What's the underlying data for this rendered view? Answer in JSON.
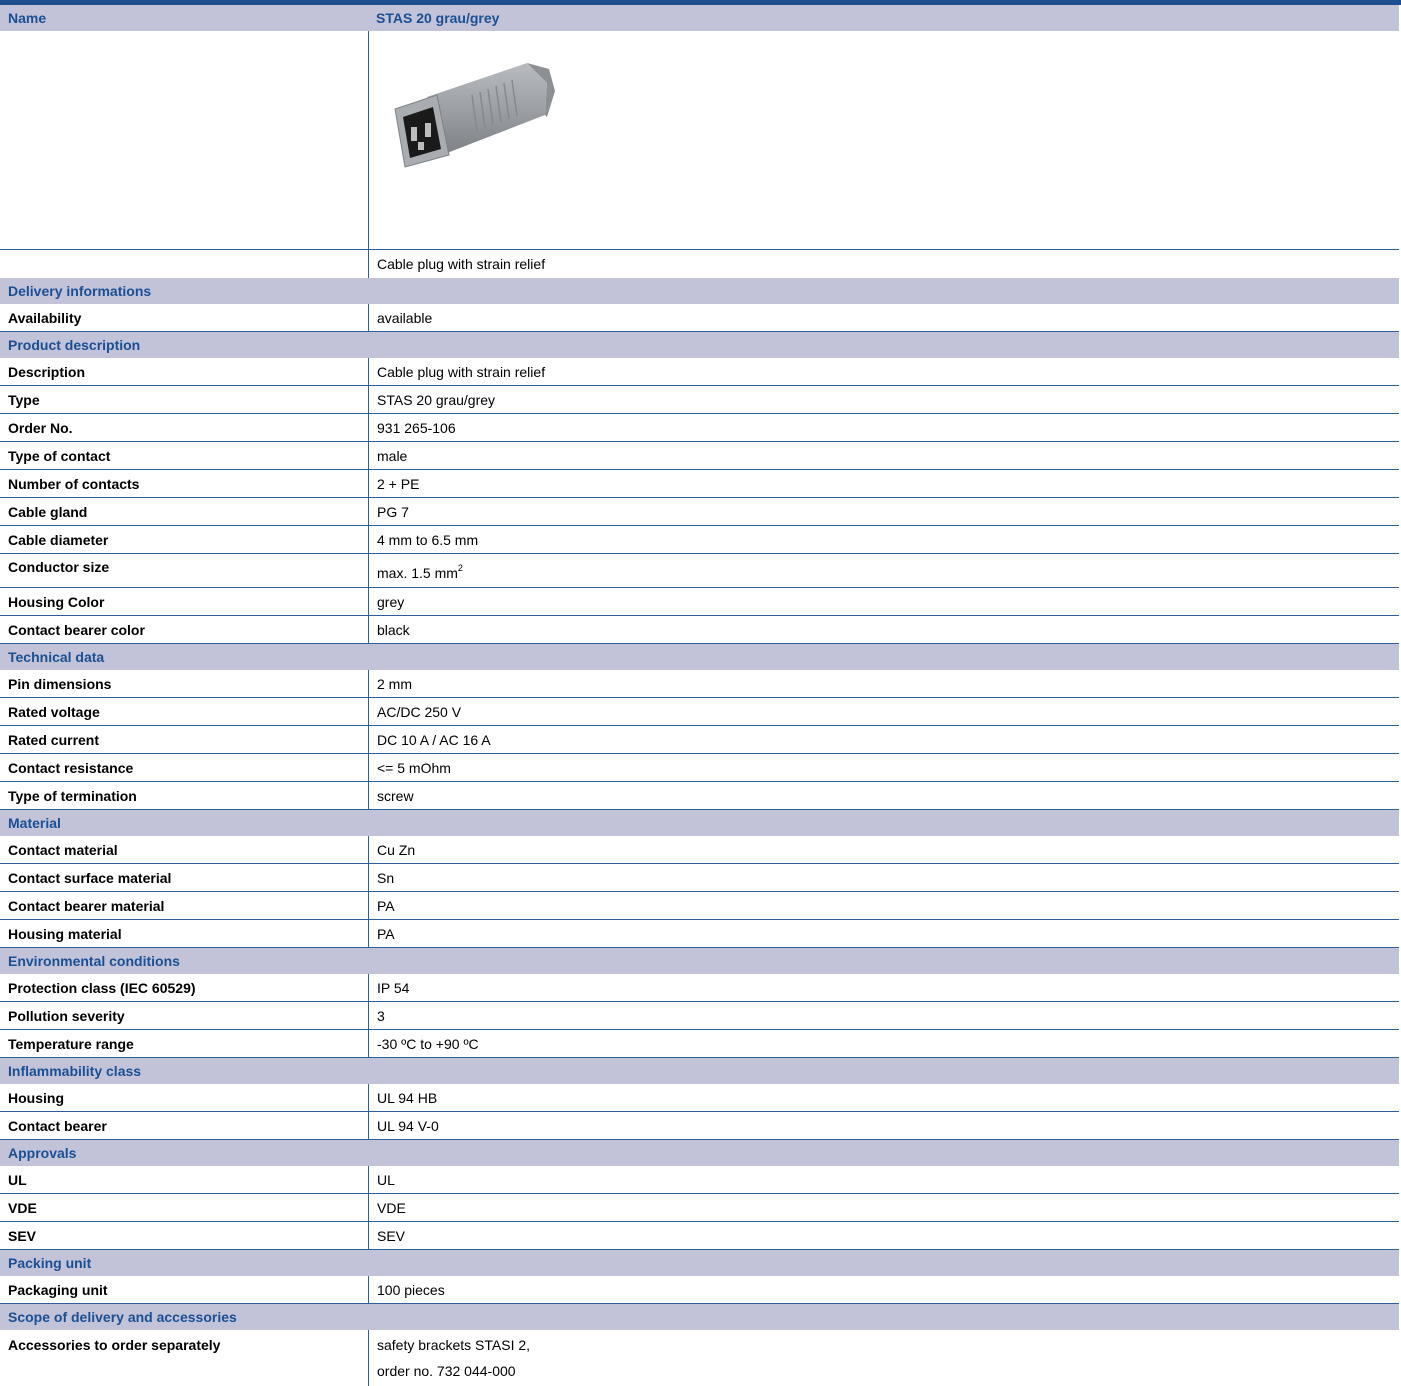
{
  "header": {
    "name_label": "Name",
    "product_name": "STAS 20 grau/grey"
  },
  "image": {
    "caption": "Cable plug with strain relief",
    "housing_color": "#9a9ea3",
    "contact_color": "#1a1a1a"
  },
  "delivery": {
    "title": "Delivery informations",
    "rows": [
      {
        "key": "Availability",
        "value": "available"
      }
    ]
  },
  "product": {
    "title": "Product description",
    "rows": [
      {
        "key": "Description",
        "value": "Cable plug with strain relief"
      },
      {
        "key": "Type",
        "value": "STAS 20 grau/grey"
      },
      {
        "key": "Order No.",
        "value": "931 265-106"
      },
      {
        "key": "Type of contact",
        "value": "male"
      },
      {
        "key": "Number of contacts",
        "value": "2 + PE"
      },
      {
        "key": "Cable gland",
        "value": "PG 7"
      },
      {
        "key": "Cable diameter",
        "value": "4 mm to 6.5 mm"
      },
      {
        "key": "Conductor size",
        "value": "max. 1.5 mm",
        "sup": "2"
      },
      {
        "key": "Housing Color",
        "value": "grey"
      },
      {
        "key": "Contact bearer color",
        "value": "black"
      }
    ]
  },
  "technical": {
    "title": "Technical data",
    "rows": [
      {
        "key": "Pin dimensions",
        "value": "2 mm"
      },
      {
        "key": "Rated voltage",
        "value": "AC/DC 250 V"
      },
      {
        "key": "Rated current",
        "value": "DC 10 A / AC 16 A"
      },
      {
        "key": "Contact resistance",
        "value": "<= 5 mOhm"
      },
      {
        "key": "Type of termination",
        "value": "screw"
      }
    ]
  },
  "material": {
    "title": "Material",
    "rows": [
      {
        "key": "Contact material",
        "value": "Cu Zn"
      },
      {
        "key": "Contact surface material",
        "value": "Sn"
      },
      {
        "key": "Contact bearer material",
        "value": "PA"
      },
      {
        "key": "Housing material",
        "value": "PA"
      }
    ]
  },
  "environment": {
    "title": "Environmental conditions",
    "rows": [
      {
        "key": "Protection class (IEC 60529)",
        "value": "IP 54"
      },
      {
        "key": "Pollution severity",
        "value": "3"
      },
      {
        "key": "Temperature range",
        "value": "-30 ºC to +90 ºC"
      }
    ]
  },
  "inflammability": {
    "title": "Inflammability class",
    "rows": [
      {
        "key": "Housing",
        "value": "UL 94 HB"
      },
      {
        "key": "Contact bearer",
        "value": "UL 94 V-0"
      }
    ]
  },
  "approvals": {
    "title": "Approvals",
    "rows": [
      {
        "key": "UL",
        "value": "UL"
      },
      {
        "key": "VDE",
        "value": "VDE"
      },
      {
        "key": "SEV",
        "value": "SEV"
      }
    ]
  },
  "packing": {
    "title": "Packing unit",
    "rows": [
      {
        "key": "Packaging unit",
        "value": "100 pieces"
      }
    ]
  },
  "scope": {
    "title": "Scope of delivery and accessories",
    "rows": [
      {
        "key": "Accessories to order separately",
        "lines": [
          "safety brackets STASI 2,",
          "order no. 732 044-000"
        ]
      }
    ]
  }
}
